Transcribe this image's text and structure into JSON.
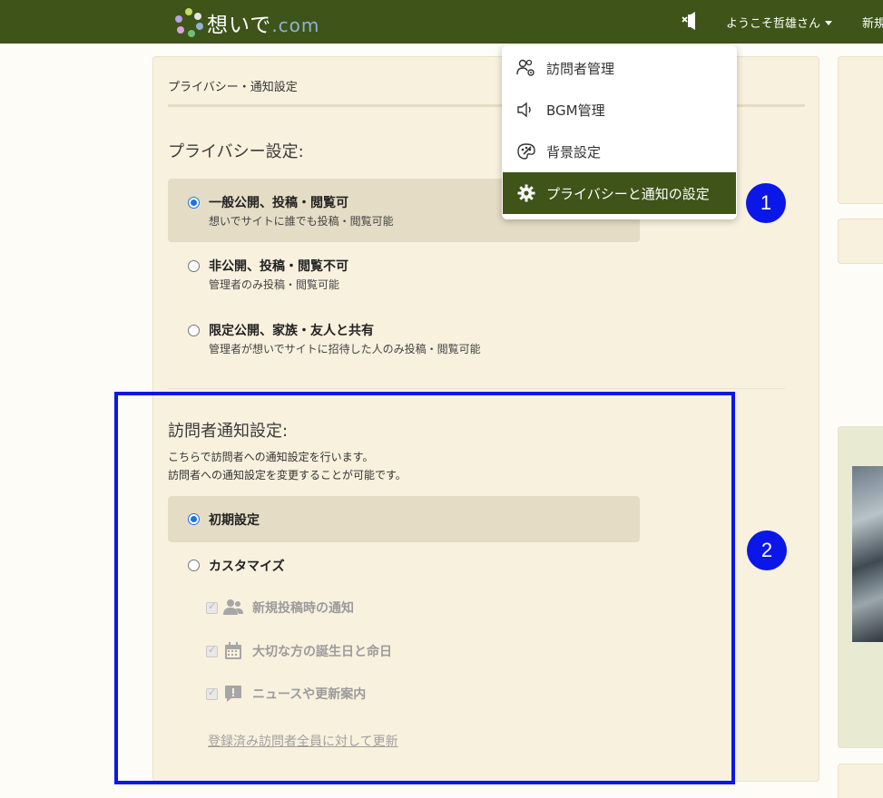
{
  "header": {
    "logo_text": "想いで",
    "logo_suffix": ".com",
    "mute_icon": "speaker-mute-icon",
    "welcome": "ようこそ哲雄さん",
    "new_button": "新規"
  },
  "breadcrumb": "プライバシー・通知設定",
  "privacy": {
    "title": "プライバシー設定:",
    "options": [
      {
        "label": "一般公開、投稿・閲覧可",
        "desc": "想いでサイトに誰でも投稿・閲覧可能",
        "selected": true
      },
      {
        "label": "非公開、投稿・閲覧不可",
        "desc": "管理者のみ投稿・閲覧可能",
        "selected": false
      },
      {
        "label": "限定公開、家族・友人と共有",
        "desc": "管理者が想いでサイトに招待した人のみ投稿・閲覧可能",
        "selected": false
      }
    ]
  },
  "notify": {
    "title": "訪問者通知設定:",
    "desc1": "こちらで訪問者への通知設定を行います。",
    "desc2": "訪問者への通知設定を変更することが可能です。",
    "options": [
      {
        "label": "初期設定",
        "selected": true
      },
      {
        "label": "カスタマイズ",
        "selected": false
      }
    ],
    "checks": [
      {
        "label": "新規投稿時の通知",
        "icon": "users-icon",
        "checked": true,
        "disabled": true
      },
      {
        "label": "大切な方の誕生日と命日",
        "icon": "calendar-icon",
        "checked": true,
        "disabled": true
      },
      {
        "label": "ニュースや更新案内",
        "icon": "alert-icon",
        "checked": true,
        "disabled": true
      }
    ],
    "update_link": "登録済み訪問者全員に対して更新"
  },
  "menu": {
    "items": [
      {
        "label": "訪問者管理",
        "icon": "visitor-settings-icon",
        "active": false
      },
      {
        "label": "BGM管理",
        "icon": "speaker-icon",
        "active": false
      },
      {
        "label": "背景設定",
        "icon": "palette-icon",
        "active": false
      },
      {
        "label": "プライバシーと通知の設定",
        "icon": "gear-icon",
        "active": true
      }
    ]
  },
  "callouts": [
    "1",
    "2"
  ],
  "colors": {
    "header_bg": "#3e5418",
    "panel_bg": "#f8f1de",
    "selected_bg": "#e4dcc5",
    "callout": "#0a17e8",
    "radio_on": "#1a73e8"
  }
}
